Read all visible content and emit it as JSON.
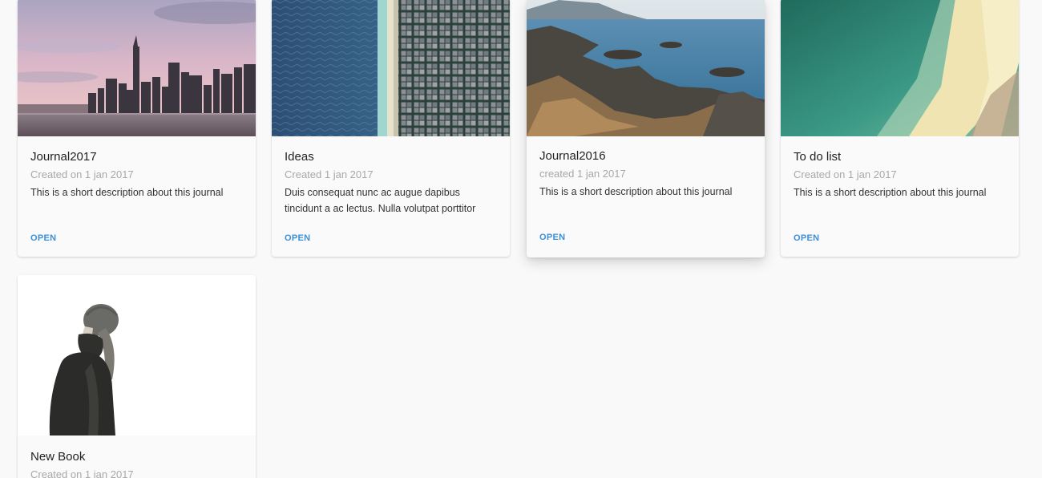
{
  "colors": {
    "background": "#f9f9f9",
    "card": "#fafafa",
    "accent": "#3b8fd8"
  },
  "cards": [
    {
      "title": "Journal2017",
      "created": "Created on 1 jan 2017",
      "description": "This is a short description about this journal",
      "action": "OPEN",
      "image": "city-skyline-photo"
    },
    {
      "title": "Ideas",
      "created": "Created 1 jan 2017",
      "description": "Duis consequat nunc ac augue dapibus tincidunt a ac lectus. Nulla volutpat porttitor risus, ac interdum diam efficitur nec. Vivamus",
      "action": "OPEN",
      "image": "aerial-coast-city-photo"
    },
    {
      "title": "Journal2016",
      "created": "created 1 jan 2017",
      "description": "This is a short description about this journal",
      "action": "OPEN",
      "image": "rocky-coast-photo"
    },
    {
      "title": "To do list",
      "created": "Created on 1 jan 2017",
      "description": "This is a short description about this journal",
      "action": "OPEN",
      "image": "aerial-beach-photo"
    },
    {
      "title": "New Book",
      "created": "Created on 1 jan 2017",
      "image": "person-in-hood-photo"
    }
  ]
}
